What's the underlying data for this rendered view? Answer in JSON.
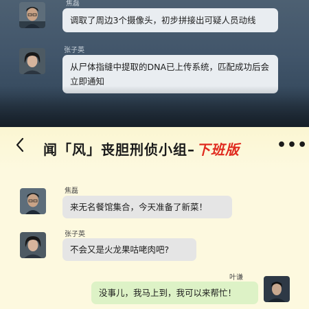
{
  "top_chat": {
    "messages": [
      {
        "sender": "焦磊",
        "text": "调取了周边3个摄像头，初步拼接出可疑人员动线"
      },
      {
        "sender": "张子英",
        "text": "从尸体指缝中提取的DNA已上传系统，匹配成功后会立即通知"
      }
    ]
  },
  "header": {
    "back_icon": "chevron-left-icon",
    "title_main": "闻「风」丧胆刑侦小组–",
    "title_tag": "下班版",
    "more_icon": "more-dots-icon",
    "more_glyph": "•••",
    "colors": {
      "background": "#fdf9df",
      "tag": "#e02a1e"
    }
  },
  "bottom_chat": {
    "messages": [
      {
        "sender": "焦磊",
        "text": "来无名餐馆集合，今天准备了新菜！",
        "side": "left"
      },
      {
        "sender": "张子英",
        "text": "不会又是火龙果咕咾肉吧?",
        "side": "left"
      },
      {
        "sender": "叶谦",
        "text": "没事儿，我马上到，我可以来帮忙！",
        "side": "right"
      }
    ],
    "colors": {
      "left_bubble": "#e5e5e5",
      "right_bubble": "#ddf2c6"
    }
  }
}
